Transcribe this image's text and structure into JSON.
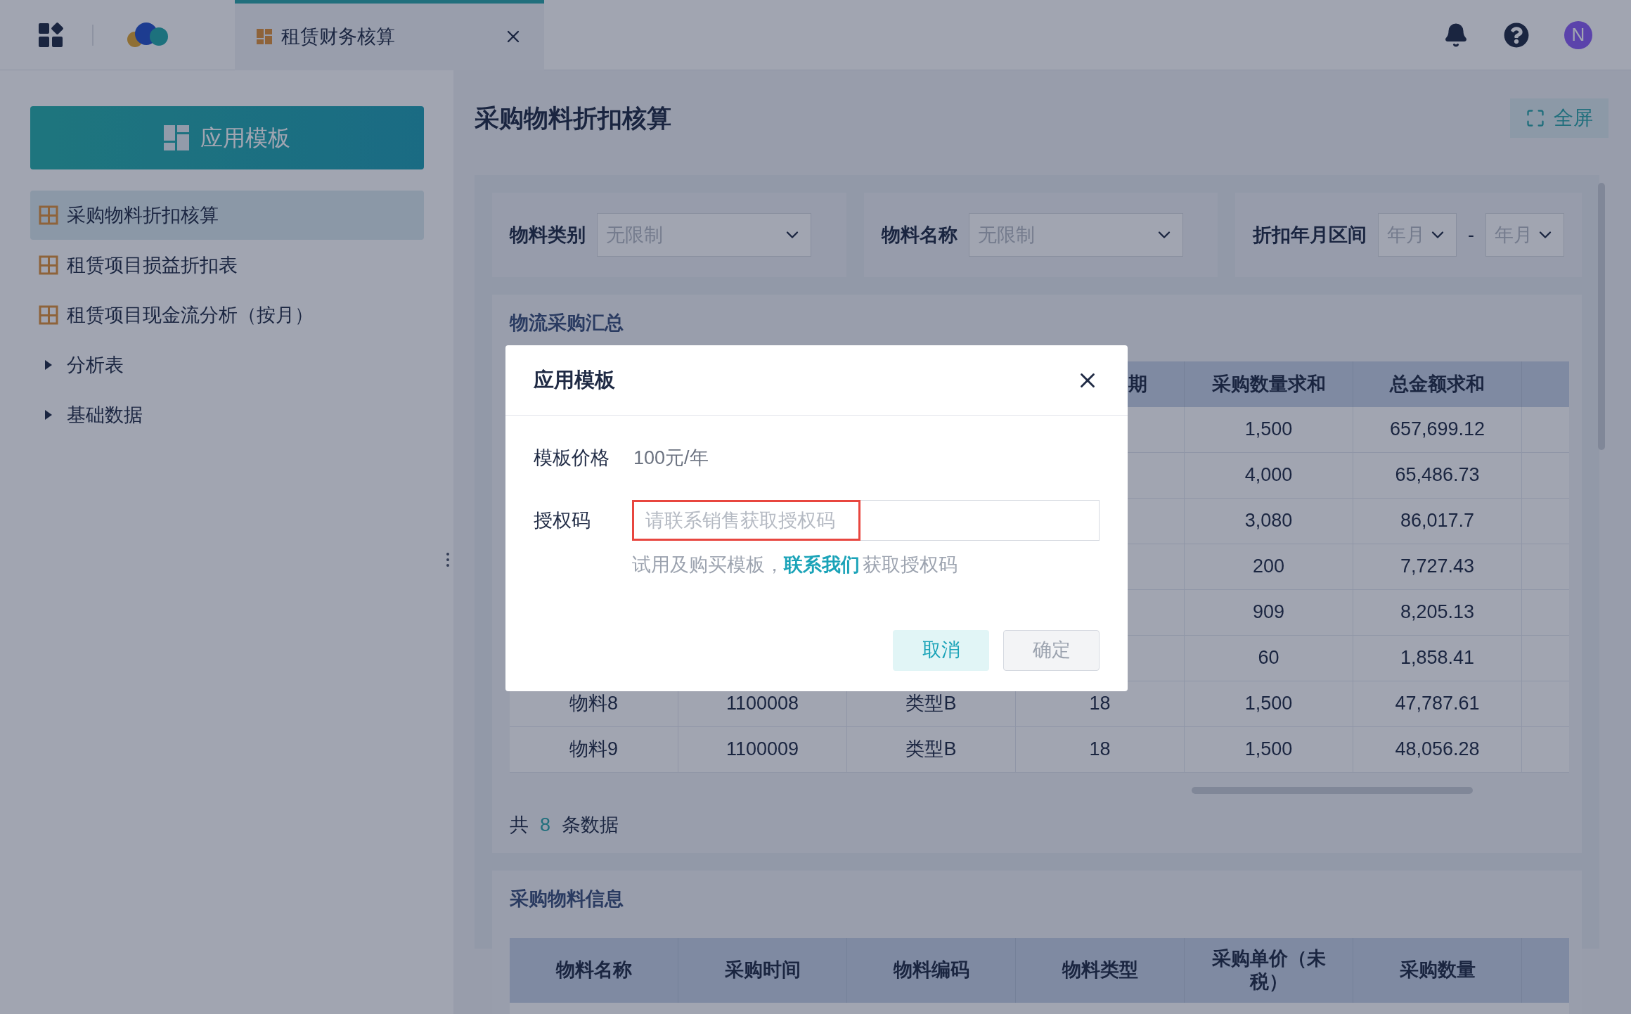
{
  "topbar": {
    "tabs": [
      {
        "label": "租赁财务核算",
        "selected": true
      }
    ],
    "avatar": "N"
  },
  "sidebar": {
    "apply_button": "应用模板",
    "items": [
      {
        "kind": "report",
        "label": "采购物料折扣核算",
        "selected": true
      },
      {
        "kind": "report",
        "label": "租赁项目损益折扣表",
        "selected": false
      },
      {
        "kind": "report",
        "label": "租赁项目现金流分析（按月）",
        "selected": false
      },
      {
        "kind": "folder",
        "label": "分析表",
        "expanded": false,
        "selected": false
      },
      {
        "kind": "folder",
        "label": "基础数据",
        "expanded": false,
        "selected": false
      }
    ]
  },
  "page": {
    "title": "采购物料折扣核算",
    "fullscreen_button": "全屏",
    "filters": [
      {
        "label": "物料类别",
        "selects": [
          "无限制"
        ]
      },
      {
        "label": "物料名称",
        "selects": [
          "无限制"
        ]
      },
      {
        "label": "折扣年月区间",
        "selects": [
          "年月",
          "年月"
        ],
        "separator": "-"
      }
    ],
    "summary_table": {
      "title": "物流采购汇总",
      "columns": [
        null,
        null,
        null,
        "期",
        "采购数量求和",
        "总金额求和",
        null
      ],
      "rows": [
        [
          null,
          null,
          null,
          null,
          "1,500",
          "657,699.12",
          null
        ],
        [
          null,
          null,
          null,
          null,
          "4,000",
          "65,486.73",
          null
        ],
        [
          null,
          null,
          null,
          null,
          "3,080",
          "86,017.7",
          null
        ],
        [
          null,
          null,
          null,
          null,
          "200",
          "7,727.43",
          null
        ],
        [
          null,
          null,
          null,
          null,
          "909",
          "8,205.13",
          null
        ],
        [
          null,
          null,
          null,
          null,
          "60",
          "1,858.41",
          null
        ],
        [
          "物料8",
          "1100008",
          "类型B",
          "18",
          "1,500",
          "47,787.61",
          null
        ],
        [
          "物料9",
          "1100009",
          "类型B",
          "18",
          "1,500",
          "48,056.28",
          null
        ]
      ],
      "footer": {
        "prefix": "共",
        "count": "8",
        "suffix": "条数据"
      }
    },
    "detail_table": {
      "title": "采购物料信息",
      "columns": [
        "物料名称",
        "采购时间",
        "物料编码",
        "物料类型",
        "采购单价（未税）",
        "采购数量"
      ]
    }
  },
  "dialog": {
    "title": "应用模板",
    "price_label": "模板价格",
    "price_value": "100元/年",
    "code_label": "授权码",
    "code_placeholder": "请联系销售获取授权码",
    "hint_prefix": "试用及购买模板，",
    "hint_link": "联系我们",
    "hint_suffix": "获取授权码",
    "buttons": [
      {
        "kind": "secondary",
        "label": "取消",
        "disabled": false
      },
      {
        "kind": "primary",
        "label": "确定",
        "disabled": true
      }
    ]
  }
}
